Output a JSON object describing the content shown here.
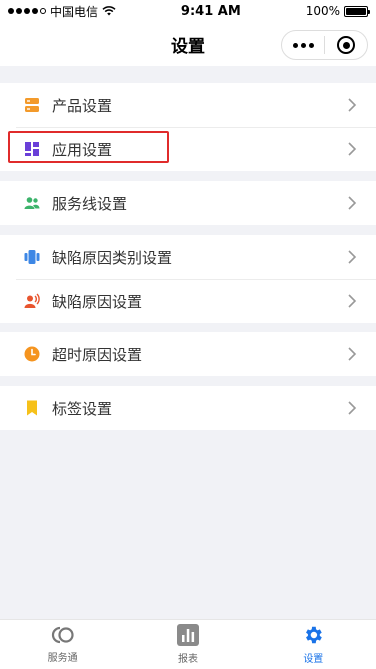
{
  "status_bar": {
    "carrier": "中国电信",
    "time": "9:41 AM",
    "battery": "100%"
  },
  "nav": {
    "title": "设置"
  },
  "groups": [
    {
      "items": [
        {
          "label": "产品设置",
          "icon": "server-icon",
          "color": "#f39a2b"
        },
        {
          "label": "应用设置",
          "icon": "app-grid-icon",
          "color": "#6a3fd8"
        }
      ]
    },
    {
      "items": [
        {
          "label": "服务线设置",
          "icon": "people-icon",
          "color": "#3cb36b"
        }
      ]
    },
    {
      "items": [
        {
          "label": "缺陷原因类别设置",
          "icon": "category-icon",
          "color": "#3d87e5"
        },
        {
          "label": "缺陷原因设置",
          "icon": "speaker-person-icon",
          "color": "#e8552f"
        }
      ]
    },
    {
      "items": [
        {
          "label": "超时原因设置",
          "icon": "clock-icon",
          "color": "#f5941f"
        }
      ]
    },
    {
      "items": [
        {
          "label": "标签设置",
          "icon": "bookmark-icon",
          "color": "#f6c11a"
        }
      ]
    }
  ],
  "tabs": [
    {
      "label": "服务通",
      "icon": "service-logo-icon",
      "active": false
    },
    {
      "label": "报表",
      "icon": "bar-chart-icon",
      "active": false
    },
    {
      "label": "设置",
      "icon": "gear-icon",
      "active": true
    }
  ],
  "colors": {
    "accent": "#1a73e8",
    "highlight_border": "#e02b2b",
    "background": "#f1f2f6"
  }
}
